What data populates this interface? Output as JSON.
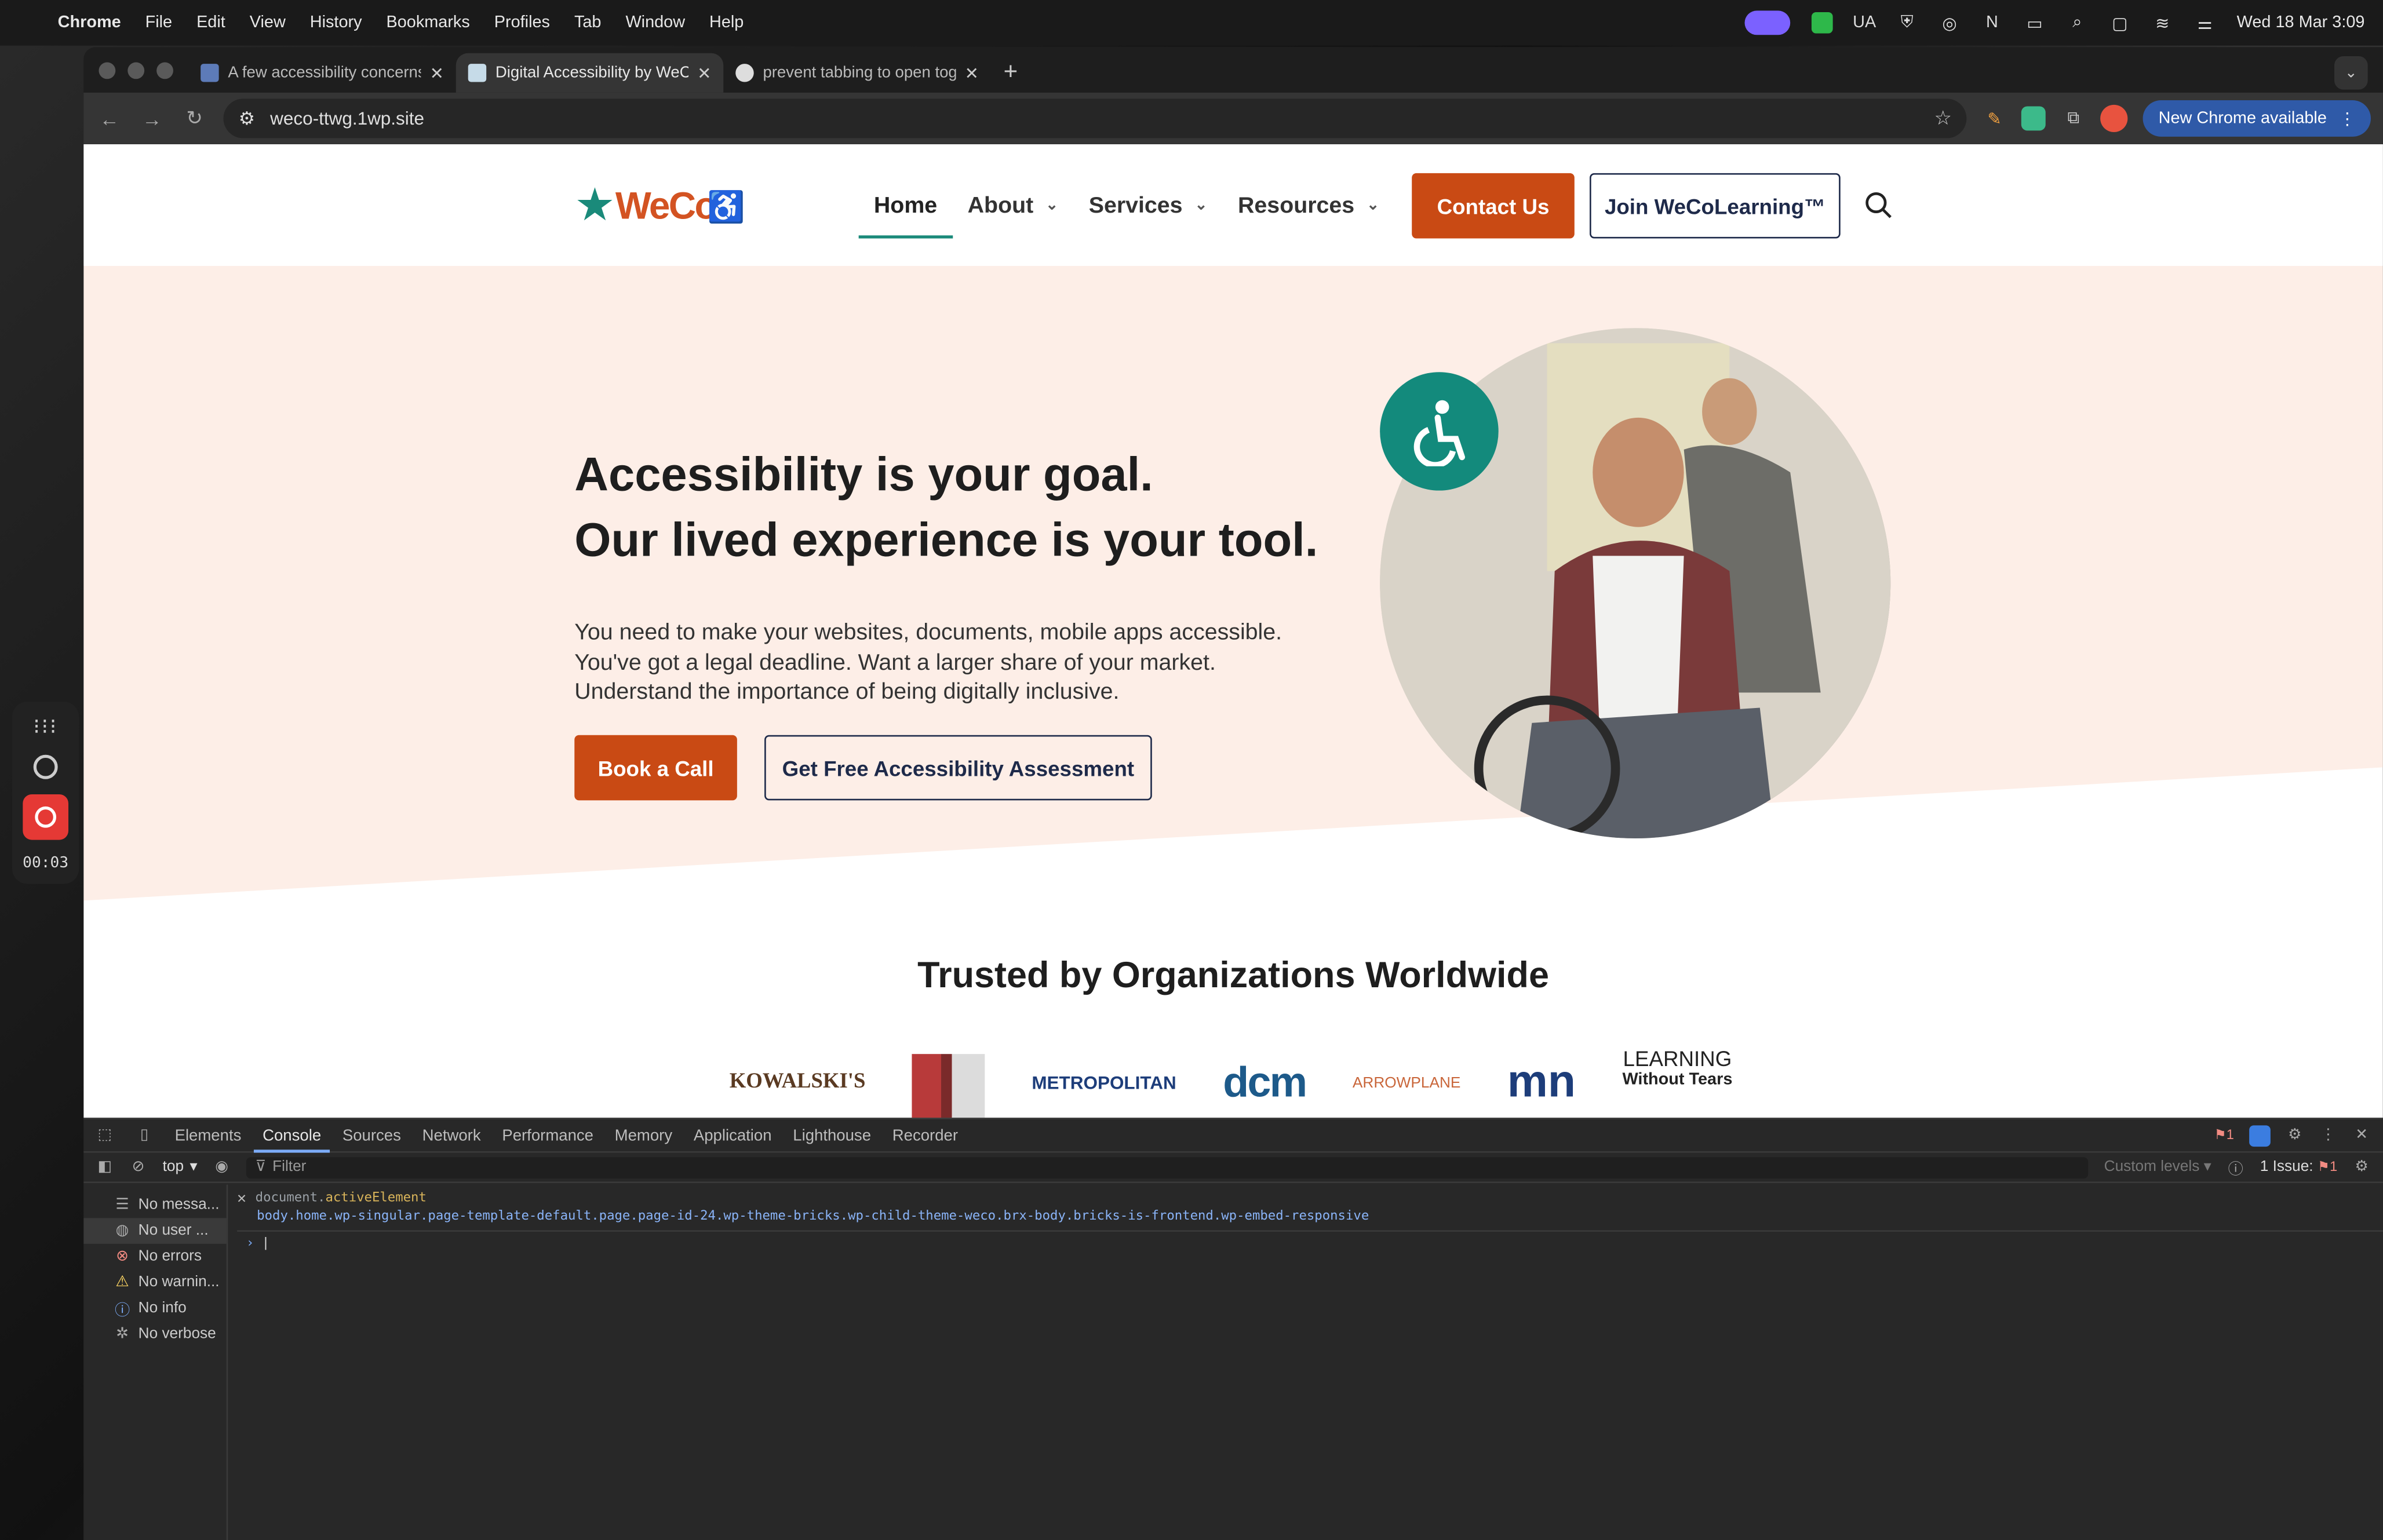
{
  "menubar": {
    "app": "Chrome",
    "items": [
      "File",
      "Edit",
      "View",
      "History",
      "Bookmarks",
      "Profiles",
      "Tab",
      "Window",
      "Help"
    ],
    "status_text": "UA",
    "datetime": "Wed 18 Mar  3:09"
  },
  "recorder": {
    "time": "00:03"
  },
  "tabs": [
    {
      "title": "A few accessibility concerns i",
      "close": "✕"
    },
    {
      "title": "Digital Accessibility by WeCo",
      "close": "✕"
    },
    {
      "title": "prevent tabbing to open togg",
      "close": "✕"
    }
  ],
  "toolbar": {
    "url": "weco-ttwg.1wp.site",
    "new_chrome": "New Chrome available"
  },
  "site": {
    "logo_text": "WeCo",
    "nav": [
      {
        "label": "Home"
      },
      {
        "label": "About"
      },
      {
        "label": "Services"
      },
      {
        "label": "Resources"
      }
    ],
    "contact": "Contact Us",
    "join": "Join WeCoLearning™",
    "hero_line1": "Accessibility is your goal.",
    "hero_line2": "Our lived experience is your tool.",
    "hero_p1": "You need to make your websites, documents, mobile apps accessible.",
    "hero_p2": "You've got a legal deadline. Want a larger share of your market.",
    "hero_p3": "Understand the importance of being digitally inclusive.",
    "book": "Book a Call",
    "assess": "Get Free Accessibility Assessment",
    "trusted": "Trusted by Organizations Worldwide",
    "logos": {
      "kowalskis": "KOWALSKI'S",
      "metropolitan": "METROPOLITAN",
      "dcm": "dcm",
      "arrowplane": "ARROWPLANE",
      "mndot": "mn",
      "lwt1": "LEARNING",
      "lwt2": "Without Tears"
    }
  },
  "devtools": {
    "tabs": [
      "Elements",
      "Console",
      "Sources",
      "Network",
      "Performance",
      "Memory",
      "Application",
      "Lighthouse",
      "Recorder"
    ],
    "error_count": "1",
    "context": "top",
    "filter_placeholder": "Filter",
    "levels": "Custom levels",
    "issues": "1 Issue:",
    "issues_count": "1",
    "sidebar": [
      {
        "label": "No messa...",
        "icon": "list-icon"
      },
      {
        "label": "No user ...",
        "icon": "user-icon"
      },
      {
        "label": "No errors",
        "icon": "error-icon"
      },
      {
        "label": "No warnin...",
        "icon": "warning-icon"
      },
      {
        "label": "No info",
        "icon": "info-icon"
      },
      {
        "label": "No verbose",
        "icon": "bug-icon"
      }
    ],
    "command_obj": "document.",
    "command_prop": "activeElement",
    "result": "body.home.wp-singular.page-template-default.page.page-id-24.wp-theme-bricks.wp-child-theme-weco.brx-body.bricks-is-frontend.wp-embed-responsive"
  }
}
